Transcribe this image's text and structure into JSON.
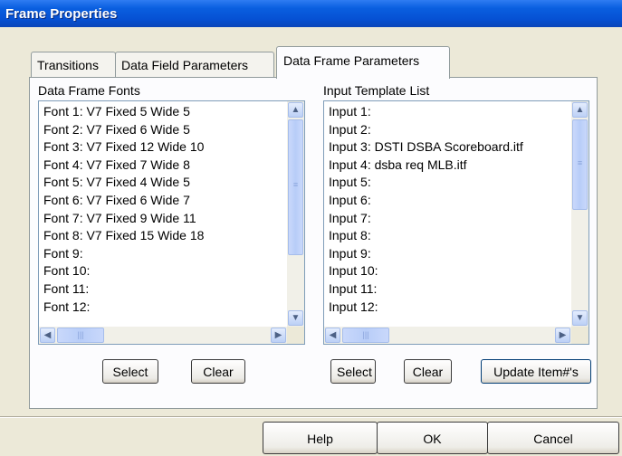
{
  "window": {
    "title": "Frame Properties"
  },
  "tabs": [
    {
      "label": "Transitions",
      "active": false
    },
    {
      "label": "Data Field Parameters",
      "active": false
    },
    {
      "label": "Data Frame Parameters",
      "active": true
    }
  ],
  "fonts_group": {
    "label": "Data Frame Fonts",
    "items": [
      "Font  1: V7 Fixed  5 Wide  5",
      "Font  2: V7 Fixed  6 Wide  5",
      "Font  3: V7 Fixed 12 Wide  10",
      "Font  4: V7 Fixed  7 Wide  8",
      "Font  5: V7 Fixed  4 Wide  5",
      "Font  6: V7 Fixed  6 Wide  7",
      "Font  7: V7 Fixed  9 Wide  11",
      "Font  8: V7 Fixed 15 Wide  18",
      "Font  9:",
      "Font 10:",
      "Font 11:",
      "Font 12:"
    ],
    "select_label": "Select",
    "clear_label": "Clear"
  },
  "templates_group": {
    "label": "Input Template List",
    "items": [
      "Input 1:",
      "Input 2:",
      "Input 3: DSTI DSBA Scoreboard.itf",
      "Input 4: dsba req MLB.itf",
      "Input 5:",
      "Input 6:",
      "Input 7:",
      "Input 8:",
      "Input 9:",
      "Input 10:",
      "Input 11:",
      "Input 12:"
    ],
    "select_label": "Select",
    "clear_label": "Clear",
    "update_label": "Update Item#'s"
  },
  "footer": {
    "help_label": "Help",
    "ok_label": "OK",
    "cancel_label": "Cancel"
  },
  "icons": {
    "scroll_up": "▲",
    "scroll_down": "▼",
    "scroll_left": "◀",
    "scroll_right": "▶",
    "grip_v": "≡",
    "grip_h": "|||"
  },
  "colors": {
    "titlebar": "#0a5fe0",
    "dialog_bg": "#ece9d8",
    "panel_bg": "#fcfcfe",
    "scrollbar_accent": "#bcd0f6"
  }
}
